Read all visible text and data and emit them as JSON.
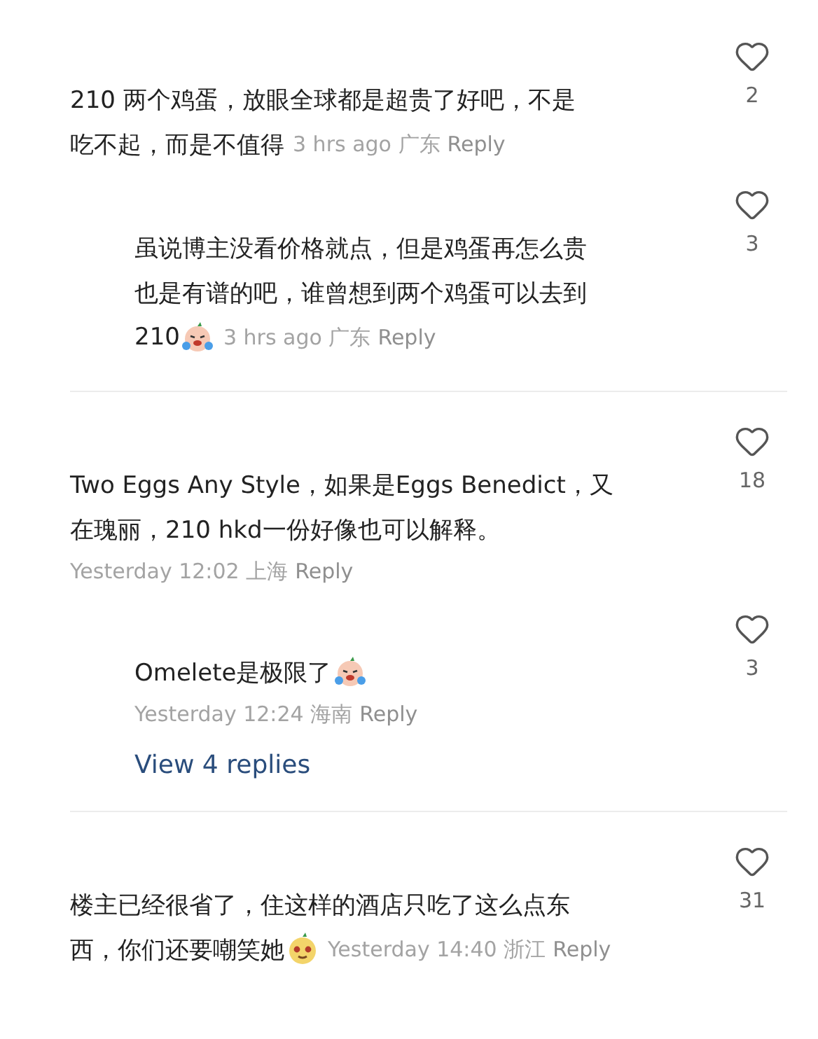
{
  "threads": [
    {
      "comment": {
        "lines": [
          "210 两个鸡蛋，放眼全球都是超贵了好吧，不是",
          "吃不起，而是不值得"
        ],
        "meta": {
          "time": "3 hrs ago",
          "region": "广东",
          "reply": "Reply"
        },
        "likes": "2"
      },
      "replies": [
        {
          "lines": [
            "虽说博主没看价格就点，但是鸡蛋再怎么贵",
            "也是有谱的吧，谁曾想到两个鸡蛋可以去到",
            "210"
          ],
          "emoji": {
            "kind": "crying"
          },
          "meta": {
            "time": "3 hrs ago",
            "region": "广东",
            "reply": "Reply"
          },
          "likes": "3"
        }
      ]
    },
    {
      "comment": {
        "lines": [
          "Two Eggs Any Style，如果是Eggs Benedict，又",
          "在瑰丽，210 hkd一份好像也可以解释。"
        ],
        "meta_line": {
          "time": "Yesterday 12:02",
          "region": "上海",
          "reply": "Reply"
        },
        "likes": "18"
      },
      "replies": [
        {
          "lines": [
            "Omelete是极限了"
          ],
          "emoji": {
            "kind": "crying"
          },
          "meta_line": {
            "time": "Yesterday 12:24",
            "region": "海南",
            "reply": "Reply"
          },
          "likes": "3"
        }
      ],
      "more": "View 4 replies"
    },
    {
      "comment": {
        "lines": [
          "楼主已经很省了，住这样的酒店只吃了这么点东",
          "西，你们还要嘲笑她"
        ],
        "emoji": {
          "kind": "smug"
        },
        "meta": {
          "time": "Yesterday 14:40",
          "region": "浙江",
          "reply": "Reply"
        },
        "likes": "31"
      }
    }
  ]
}
